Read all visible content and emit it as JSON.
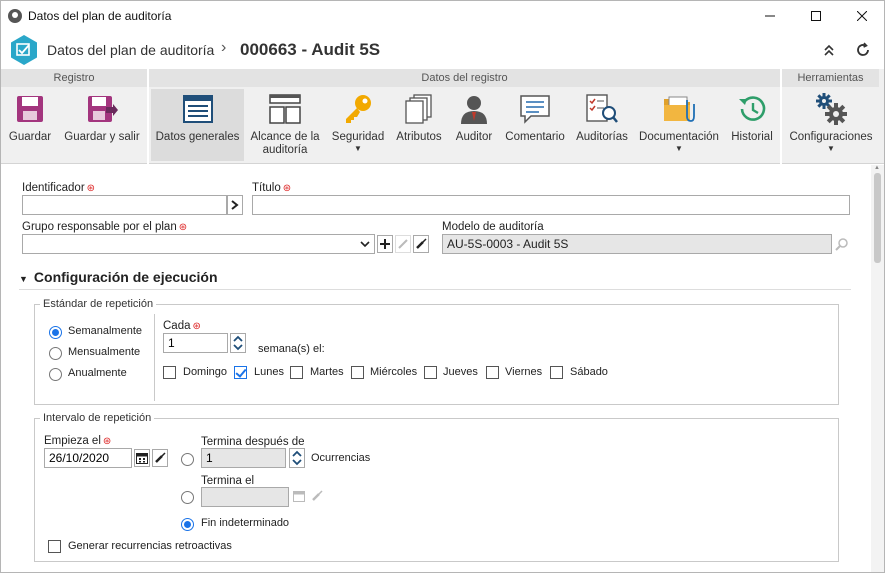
{
  "window": {
    "title": "Datos del plan de auditoría"
  },
  "header": {
    "title": "Datos del plan de auditoría",
    "separator": "›",
    "code": "000663 - Audit 5S"
  },
  "ribbon": {
    "groups": {
      "registro": "Registro",
      "datos": "Datos del registro",
      "herramientas": "Herramientas"
    },
    "buttons": {
      "guardar": "Guardar",
      "guardar_salir": "Guardar y salir",
      "datos_generales": "Datos generales",
      "alcance": "Alcance de la auditoría",
      "seguridad": "Seguridad",
      "atributos": "Atributos",
      "auditor": "Auditor",
      "comentario": "Comentario",
      "auditorias": "Auditorías",
      "documentacion": "Documentación",
      "historial": "Historial",
      "configuraciones": "Configuraciones"
    }
  },
  "form": {
    "identificador_label": "Identificador",
    "identificador_value": "",
    "titulo_label": "Título",
    "titulo_value": "",
    "grupo_label": "Grupo responsable por el plan",
    "grupo_value": "",
    "modelo_label": "Modelo de auditoría",
    "modelo_value": "AU-5S-0003 - Audit 5S",
    "section_title": "Configuración de ejecución"
  },
  "repeticion": {
    "legend": "Estándar de repetición",
    "options": [
      "Semanalmente",
      "Mensualmente",
      "Anualmente"
    ],
    "selected": "Semanalmente",
    "cada_label": "Cada",
    "cada_value": "1",
    "semana_label": "semana(s) el:",
    "days": [
      {
        "label": "Domingo",
        "checked": false
      },
      {
        "label": "Lunes",
        "checked": true
      },
      {
        "label": "Martes",
        "checked": false
      },
      {
        "label": "Miércoles",
        "checked": false
      },
      {
        "label": "Jueves",
        "checked": false
      },
      {
        "label": "Viernes",
        "checked": false
      },
      {
        "label": "Sábado",
        "checked": false
      }
    ]
  },
  "intervalo": {
    "legend": "Intervalo de repetición",
    "empieza_label": "Empieza el",
    "empieza_value": "26/10/2020",
    "termina_despues_label": "Termina después de",
    "ocurrencias_value": "1",
    "ocurrencias_label": "Ocurrencias",
    "termina_el_label": "Termina el",
    "termina_el_value": "",
    "fin_label": "Fin indeterminado",
    "end_selected": "fin",
    "retroactivas_label": "Generar recurrencias retroactivas",
    "retroactivas_checked": false
  },
  "colors": {
    "accent": "#1a73e8",
    "logo": "#2aa7c9",
    "save_icon": "#a3357e",
    "required": "#dd2222"
  }
}
